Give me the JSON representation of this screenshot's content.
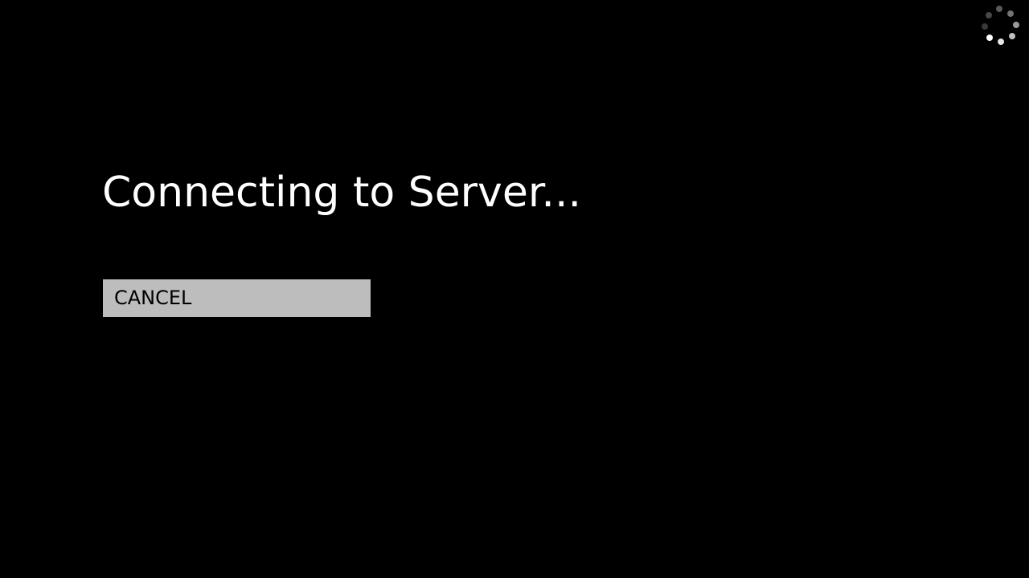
{
  "dialog": {
    "title": "Connecting to Server...",
    "cancel_label": "CANCEL"
  },
  "spinner": {
    "icon": "loading-spinner-icon"
  },
  "colors": {
    "background": "#000000",
    "text": "#ffffff",
    "button_background": "#bdbdbd",
    "button_text": "#000000"
  }
}
